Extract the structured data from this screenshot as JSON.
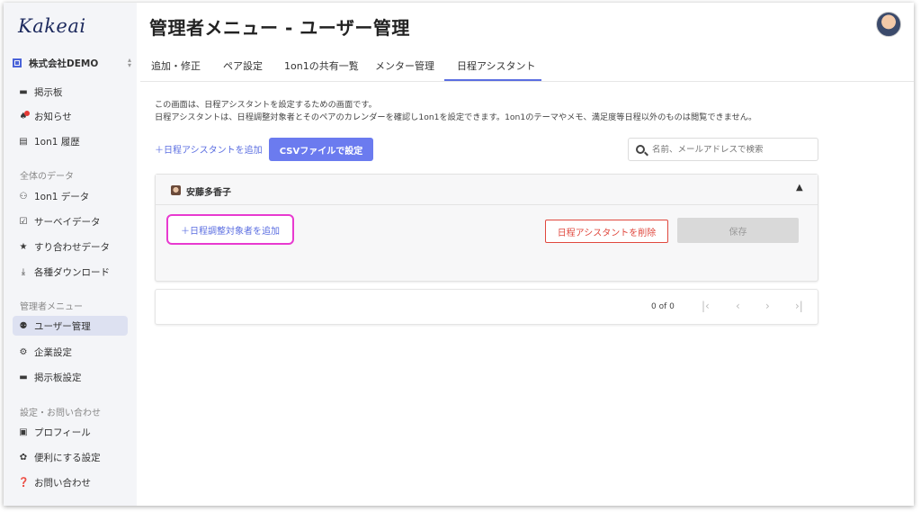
{
  "app": {
    "logo": "Kakeai",
    "company": "株式会社DEMO"
  },
  "sidebar": {
    "items": [
      {
        "label": "掲示板"
      },
      {
        "label": "お知らせ"
      },
      {
        "label": "1on1 履歴"
      }
    ],
    "section_data": "全体のデータ",
    "data_items": [
      {
        "label": "1on1 データ"
      },
      {
        "label": "サーベイデータ"
      },
      {
        "label": "すり合わせデータ"
      },
      {
        "label": "各種ダウンロード"
      }
    ],
    "section_admin": "管理者メニュー",
    "admin_items": [
      {
        "label": "ユーザー管理"
      },
      {
        "label": "企業設定"
      },
      {
        "label": "掲示板設定"
      }
    ],
    "section_settings": "設定・お問い合わせ",
    "settings_items": [
      {
        "label": "プロフィール"
      },
      {
        "label": "便利にする設定"
      },
      {
        "label": "お問い合わせ"
      }
    ]
  },
  "header": {
    "title": "管理者メニュー - ユーザー管理"
  },
  "tabs": [
    {
      "label": "追加・修正"
    },
    {
      "label": "ペア設定"
    },
    {
      "label": "1on1の共有一覧"
    },
    {
      "label": "メンター管理"
    },
    {
      "label": "日程アシスタント"
    }
  ],
  "main": {
    "desc1": "この画面は、日程アシスタントを設定するための画面です。",
    "desc2": "日程アシスタントは、日程調整対象者とそのペアのカレンダーを確認し1on1を設定できます。1on1のテーマやメモ、満足度等日程以外のものは閲覧できません。",
    "add_assistant": "＋日程アシスタントを追加",
    "csv_button": "CSVファイルで設定",
    "search_placeholder": "名前、メールアドレスで検索",
    "card": {
      "user": "安藤多香子",
      "add_target": "＋日程調整対象者を追加",
      "delete_button": "日程アシスタントを削除",
      "save_button": "保存"
    },
    "pager": {
      "count": "0 of 0"
    }
  },
  "colors": {
    "accent": "#6b7bef",
    "highlight": "#e83ad0",
    "danger": "#e0483e"
  }
}
